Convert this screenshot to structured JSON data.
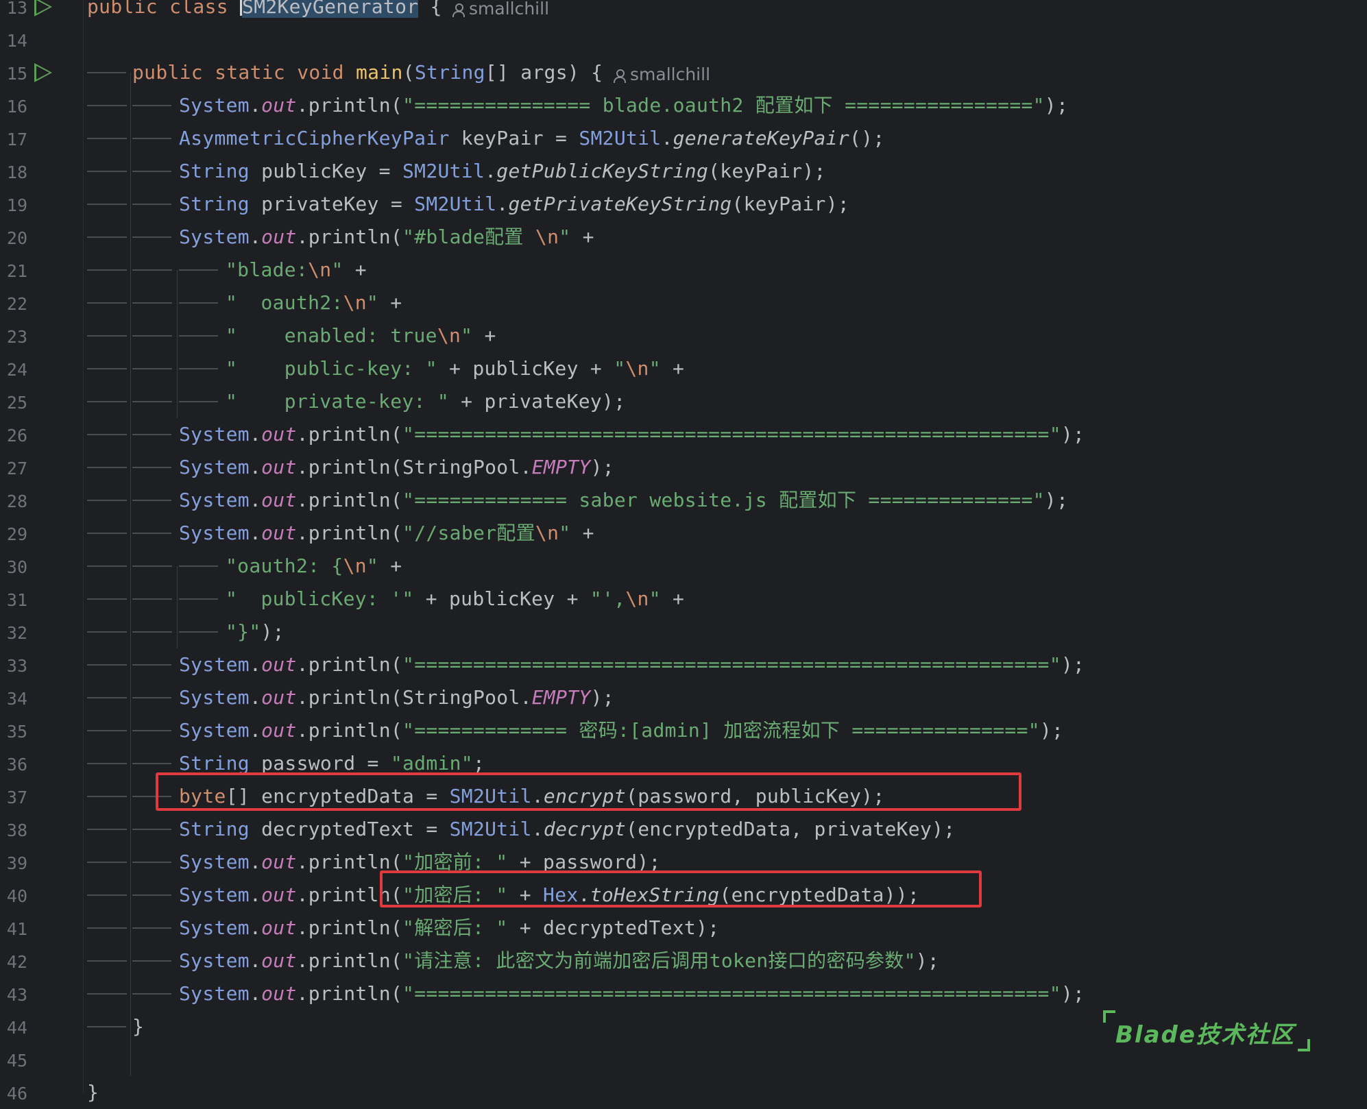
{
  "editor": {
    "author_hint": "smallchill",
    "watermark": "Blade技术社区",
    "lines": [
      {
        "n": "13",
        "tokens": [
          [
            "kw",
            "public class "
          ],
          [
            "sel",
            "SM2KeyGenerator"
          ],
          [
            "plain",
            " {"
          ]
        ]
      },
      {
        "n": "14",
        "tokens": []
      },
      {
        "n": "15",
        "tokens": [
          [
            "kw",
            "public static void "
          ],
          [
            "mth",
            "main"
          ],
          [
            "plain",
            "("
          ],
          [
            "cls",
            "String"
          ],
          [
            "plain",
            "[] args) {"
          ]
        ]
      },
      {
        "n": "16",
        "tokens": [
          [
            "cls",
            "System"
          ],
          [
            "plain",
            "."
          ],
          [
            "fld",
            "out"
          ],
          [
            "plain",
            ".println("
          ],
          [
            "str",
            "\"=============== blade.oauth2 配置如下 ================\""
          ],
          [
            "plain",
            ");"
          ]
        ]
      },
      {
        "n": "17",
        "tokens": [
          [
            "cls",
            "AsymmetricCipherKeyPair"
          ],
          [
            "plain",
            " keyPair = "
          ],
          [
            "cls",
            "SM2Util"
          ],
          [
            "plain",
            "."
          ],
          [
            "sfn",
            "generateKeyPair"
          ],
          [
            "plain",
            "();"
          ]
        ]
      },
      {
        "n": "18",
        "tokens": [
          [
            "cls",
            "String"
          ],
          [
            "plain",
            " publicKey = "
          ],
          [
            "cls",
            "SM2Util"
          ],
          [
            "plain",
            "."
          ],
          [
            "sfn",
            "getPublicKeyString"
          ],
          [
            "plain",
            "(keyPair);"
          ]
        ]
      },
      {
        "n": "19",
        "tokens": [
          [
            "cls",
            "String"
          ],
          [
            "plain",
            " privateKey = "
          ],
          [
            "cls",
            "SM2Util"
          ],
          [
            "plain",
            "."
          ],
          [
            "sfn",
            "getPrivateKeyString"
          ],
          [
            "plain",
            "(keyPair);"
          ]
        ]
      },
      {
        "n": "20",
        "tokens": [
          [
            "cls",
            "System"
          ],
          [
            "plain",
            "."
          ],
          [
            "fld",
            "out"
          ],
          [
            "plain",
            ".println("
          ],
          [
            "str",
            "\"#blade配置 "
          ],
          [
            "esc",
            "\\n"
          ],
          [
            "str",
            "\""
          ],
          [
            "plain",
            " +"
          ]
        ]
      },
      {
        "n": "21",
        "tokens": [
          [
            "str",
            "\"blade:"
          ],
          [
            "esc",
            "\\n"
          ],
          [
            "str",
            "\""
          ],
          [
            "plain",
            " +"
          ]
        ]
      },
      {
        "n": "22",
        "tokens": [
          [
            "str",
            "\"  oauth2:"
          ],
          [
            "esc",
            "\\n"
          ],
          [
            "str",
            "\""
          ],
          [
            "plain",
            " +"
          ]
        ]
      },
      {
        "n": "23",
        "tokens": [
          [
            "str",
            "\"    enabled: true"
          ],
          [
            "esc",
            "\\n"
          ],
          [
            "str",
            "\""
          ],
          [
            "plain",
            " +"
          ]
        ]
      },
      {
        "n": "24",
        "tokens": [
          [
            "str",
            "\"    public-key: \""
          ],
          [
            "plain",
            " + publicKey + "
          ],
          [
            "str",
            "\""
          ],
          [
            "esc",
            "\\n"
          ],
          [
            "str",
            "\""
          ],
          [
            "plain",
            " +"
          ]
        ]
      },
      {
        "n": "25",
        "tokens": [
          [
            "str",
            "\"    private-key: \""
          ],
          [
            "plain",
            " + privateKey);"
          ]
        ]
      },
      {
        "n": "26",
        "tokens": [
          [
            "cls",
            "System"
          ],
          [
            "plain",
            "."
          ],
          [
            "fld",
            "out"
          ],
          [
            "plain",
            ".println("
          ],
          [
            "str",
            "\"======================================================\""
          ],
          [
            "plain",
            ");"
          ]
        ]
      },
      {
        "n": "27",
        "tokens": [
          [
            "cls",
            "System"
          ],
          [
            "plain",
            "."
          ],
          [
            "fld",
            "out"
          ],
          [
            "plain",
            ".println(StringPool."
          ],
          [
            "const",
            "EMPTY"
          ],
          [
            "plain",
            ");"
          ]
        ]
      },
      {
        "n": "28",
        "tokens": [
          [
            "cls",
            "System"
          ],
          [
            "plain",
            "."
          ],
          [
            "fld",
            "out"
          ],
          [
            "plain",
            ".println("
          ],
          [
            "str",
            "\"============= saber website.js 配置如下 ==============\""
          ],
          [
            "plain",
            ");"
          ]
        ]
      },
      {
        "n": "29",
        "tokens": [
          [
            "cls",
            "System"
          ],
          [
            "plain",
            "."
          ],
          [
            "fld",
            "out"
          ],
          [
            "plain",
            ".println("
          ],
          [
            "str",
            "\"//saber配置"
          ],
          [
            "esc",
            "\\n"
          ],
          [
            "str",
            "\""
          ],
          [
            "plain",
            " +"
          ]
        ]
      },
      {
        "n": "30",
        "tokens": [
          [
            "str",
            "\"oauth2: {"
          ],
          [
            "esc",
            "\\n"
          ],
          [
            "str",
            "\""
          ],
          [
            "plain",
            " +"
          ]
        ]
      },
      {
        "n": "31",
        "tokens": [
          [
            "str",
            "\"  publicKey: '\""
          ],
          [
            "plain",
            " + publicKey + "
          ],
          [
            "str",
            "\"',"
          ],
          [
            "esc",
            "\\n"
          ],
          [
            "str",
            "\""
          ],
          [
            "plain",
            " +"
          ]
        ]
      },
      {
        "n": "32",
        "tokens": [
          [
            "str",
            "\"}\""
          ],
          [
            "plain",
            ");"
          ]
        ]
      },
      {
        "n": "33",
        "tokens": [
          [
            "cls",
            "System"
          ],
          [
            "plain",
            "."
          ],
          [
            "fld",
            "out"
          ],
          [
            "plain",
            ".println("
          ],
          [
            "str",
            "\"======================================================\""
          ],
          [
            "plain",
            ");"
          ]
        ]
      },
      {
        "n": "34",
        "tokens": [
          [
            "cls",
            "System"
          ],
          [
            "plain",
            "."
          ],
          [
            "fld",
            "out"
          ],
          [
            "plain",
            ".println(StringPool."
          ],
          [
            "const",
            "EMPTY"
          ],
          [
            "plain",
            ");"
          ]
        ]
      },
      {
        "n": "35",
        "tokens": [
          [
            "cls",
            "System"
          ],
          [
            "plain",
            "."
          ],
          [
            "fld",
            "out"
          ],
          [
            "plain",
            ".println("
          ],
          [
            "str",
            "\"============= 密码:[admin] 加密流程如下 ===============\""
          ],
          [
            "plain",
            ");"
          ]
        ]
      },
      {
        "n": "36",
        "tokens": [
          [
            "cls",
            "String"
          ],
          [
            "plain",
            " password = "
          ],
          [
            "str",
            "\"admin\""
          ],
          [
            "plain",
            ";"
          ]
        ]
      },
      {
        "n": "37",
        "tokens": [
          [
            "kw",
            "byte"
          ],
          [
            "plain",
            "[] encryptedData = "
          ],
          [
            "cls",
            "SM2Util"
          ],
          [
            "plain",
            "."
          ],
          [
            "sfn",
            "encrypt"
          ],
          [
            "plain",
            "(password, publicKey);"
          ]
        ]
      },
      {
        "n": "38",
        "tokens": [
          [
            "cls",
            "String"
          ],
          [
            "plain",
            " decryptedText = "
          ],
          [
            "cls",
            "SM2Util"
          ],
          [
            "plain",
            "."
          ],
          [
            "sfn",
            "decrypt"
          ],
          [
            "plain",
            "(encryptedData, privateKey);"
          ]
        ]
      },
      {
        "n": "39",
        "tokens": [
          [
            "cls",
            "System"
          ],
          [
            "plain",
            "."
          ],
          [
            "fld",
            "out"
          ],
          [
            "plain",
            ".println("
          ],
          [
            "str",
            "\"加密前: \""
          ],
          [
            "plain",
            " + password);"
          ]
        ]
      },
      {
        "n": "40",
        "tokens": [
          [
            "cls",
            "System"
          ],
          [
            "plain",
            "."
          ],
          [
            "fld",
            "out"
          ],
          [
            "plain",
            ".println("
          ],
          [
            "str",
            "\"加密后: \""
          ],
          [
            "plain",
            " + "
          ],
          [
            "cls",
            "Hex"
          ],
          [
            "plain",
            "."
          ],
          [
            "sfn",
            "toHexString"
          ],
          [
            "plain",
            "(encryptedData));"
          ]
        ]
      },
      {
        "n": "41",
        "tokens": [
          [
            "cls",
            "System"
          ],
          [
            "plain",
            "."
          ],
          [
            "fld",
            "out"
          ],
          [
            "plain",
            ".println("
          ],
          [
            "str",
            "\"解密后: \""
          ],
          [
            "plain",
            " + decryptedText);"
          ]
        ]
      },
      {
        "n": "42",
        "tokens": [
          [
            "cls",
            "System"
          ],
          [
            "plain",
            "."
          ],
          [
            "fld",
            "out"
          ],
          [
            "plain",
            ".println("
          ],
          [
            "str",
            "\"请注意: 此密文为前端加密后调用token接口的密码参数\""
          ],
          [
            "plain",
            ");"
          ]
        ]
      },
      {
        "n": "43",
        "tokens": [
          [
            "cls",
            "System"
          ],
          [
            "plain",
            "."
          ],
          [
            "fld",
            "out"
          ],
          [
            "plain",
            ".println("
          ],
          [
            "str",
            "\"======================================================\""
          ],
          [
            "plain",
            ");"
          ]
        ]
      },
      {
        "n": "44",
        "tokens": [
          [
            "plain",
            "}"
          ]
        ]
      },
      {
        "n": "45",
        "tokens": []
      },
      {
        "n": "46",
        "tokens": [
          [
            "plain",
            "}"
          ]
        ]
      }
    ]
  }
}
